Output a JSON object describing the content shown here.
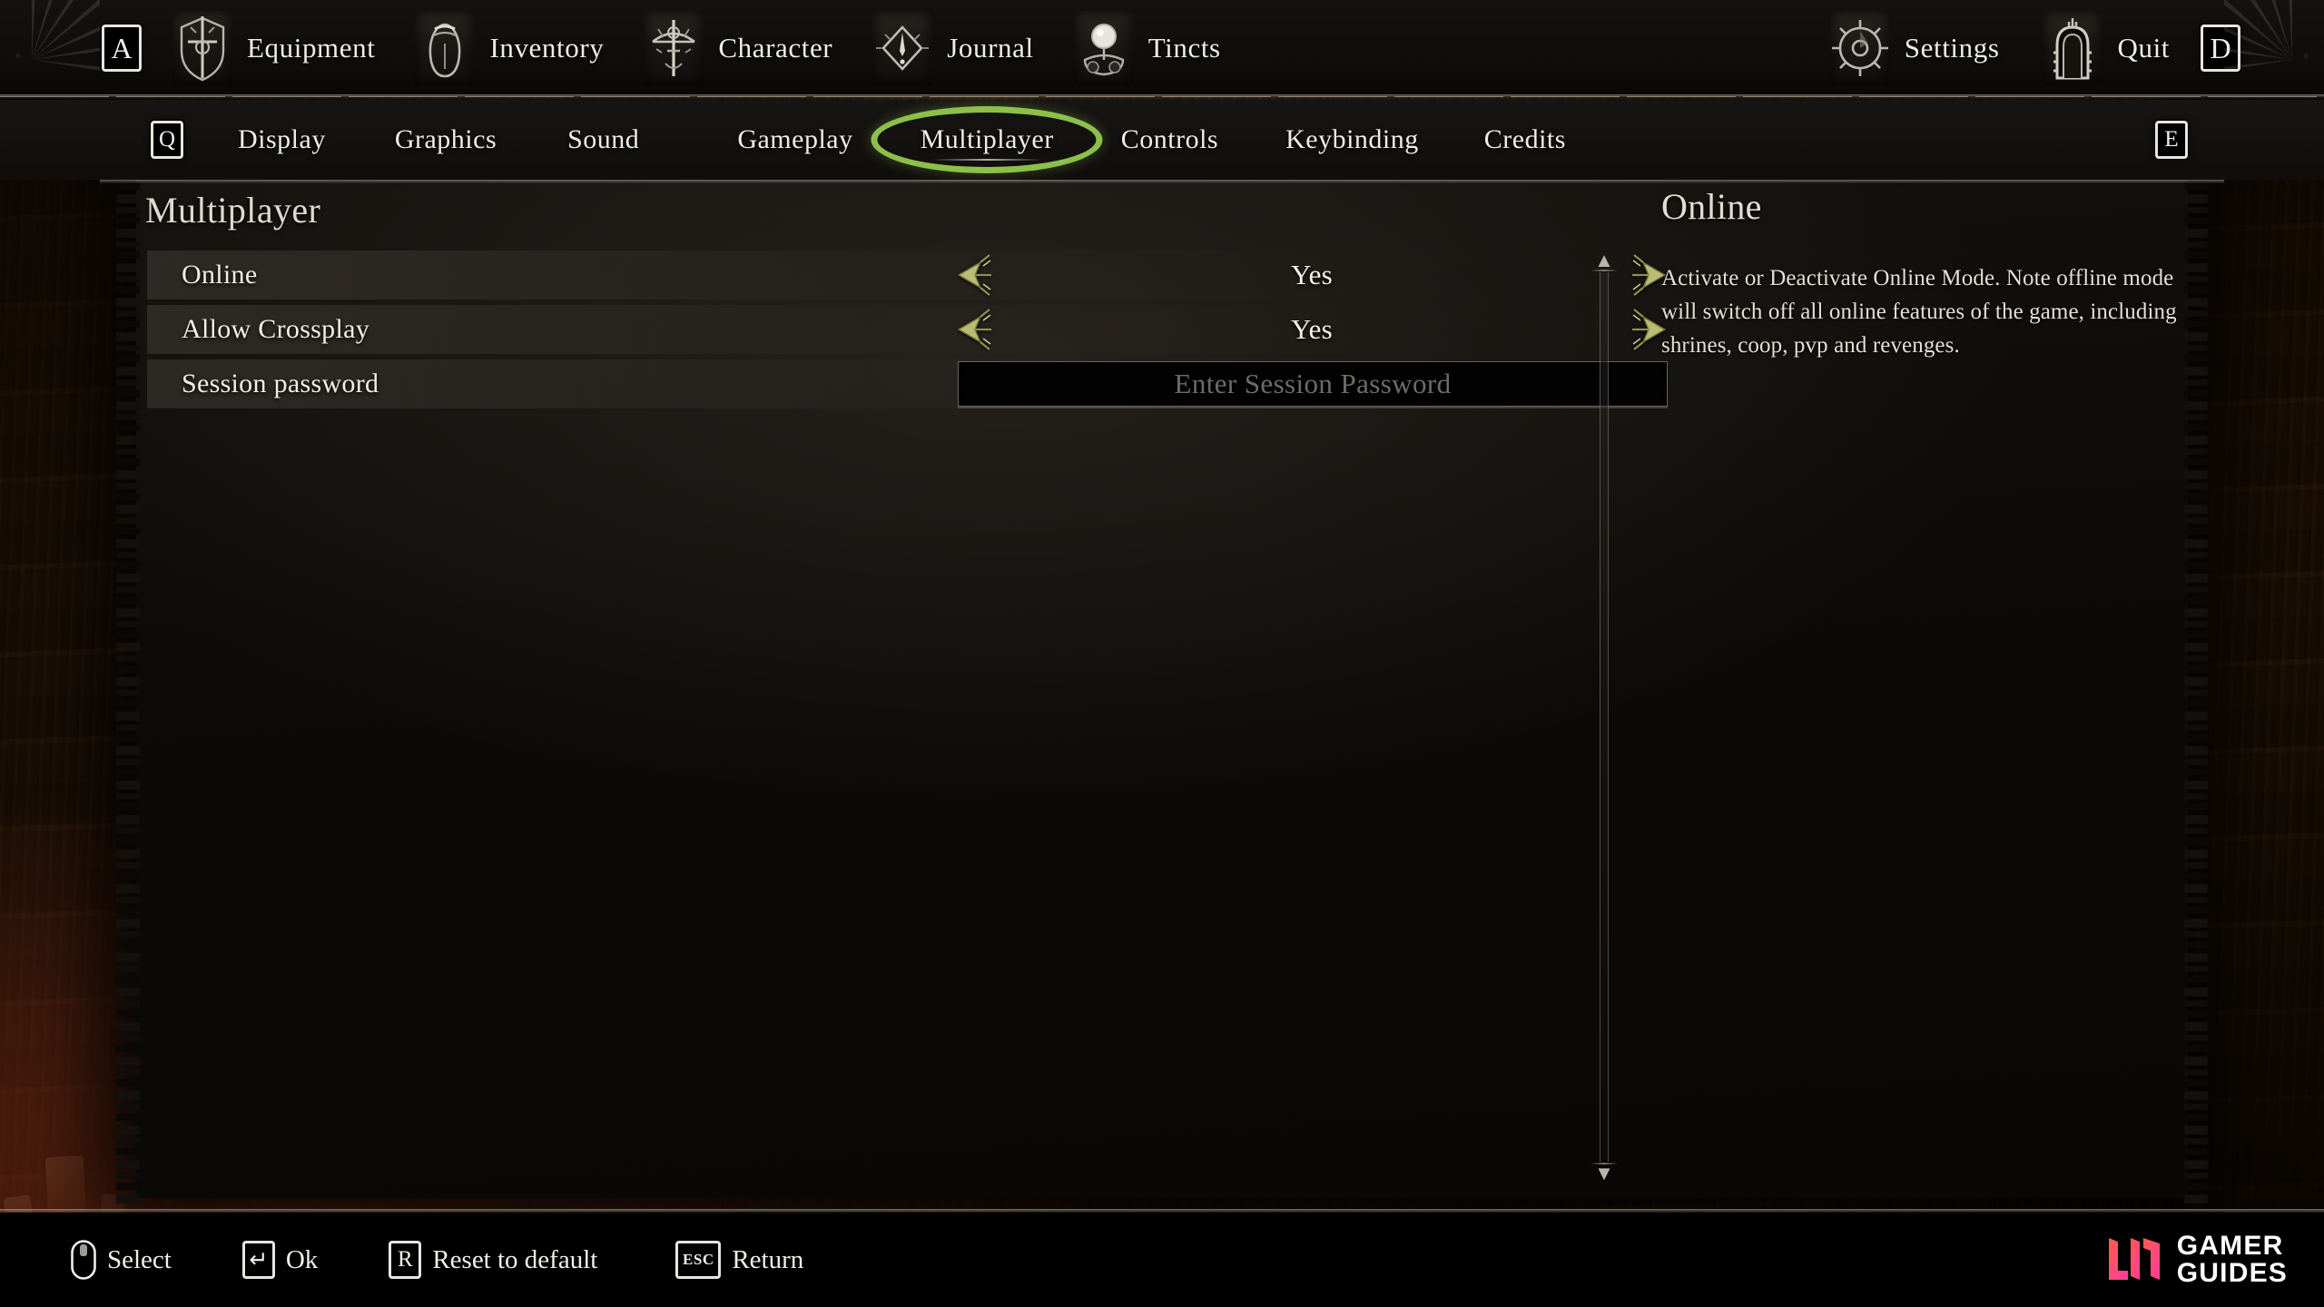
{
  "topbar": {
    "left_key": "A",
    "right_key": "D",
    "items": [
      {
        "label": "Equipment",
        "icon": "shield-sword-icon",
        "glyph": "⚔"
      },
      {
        "label": "Inventory",
        "icon": "satchel-icon",
        "glyph": "Ἱ2"
      },
      {
        "label": "Character",
        "icon": "crest-icon",
        "glyph": "☨"
      },
      {
        "label": "Journal",
        "icon": "tome-icon",
        "glyph": "❖"
      },
      {
        "label": "Tincts",
        "icon": "flask-orb-icon",
        "glyph": "●"
      }
    ],
    "right_items": [
      {
        "label": "Settings",
        "icon": "gear-icon",
        "glyph": "⚙"
      },
      {
        "label": "Quit",
        "icon": "door-icon",
        "glyph": "⛩"
      }
    ]
  },
  "tabs": {
    "prev_key": "Q",
    "next_key": "E",
    "accent_color": "#8cc04a",
    "items": [
      {
        "label": "Display",
        "active": false
      },
      {
        "label": "Graphics",
        "active": false
      },
      {
        "label": "Sound",
        "active": false
      },
      {
        "label": "Gameplay",
        "active": false
      },
      {
        "label": "Multiplayer",
        "active": true
      },
      {
        "label": "Controls",
        "active": false
      },
      {
        "label": "Keybinding",
        "active": false
      },
      {
        "label": "Credits",
        "active": false
      }
    ]
  },
  "settings": {
    "section_title": "Multiplayer",
    "rows": [
      {
        "label": "Online",
        "type": "toggle",
        "value": "Yes"
      },
      {
        "label": "Allow Crossplay",
        "type": "toggle",
        "value": "Yes"
      },
      {
        "label": "Session password",
        "type": "text",
        "value": "",
        "placeholder": "Enter Session Password"
      }
    ]
  },
  "info": {
    "title": "Online",
    "body": "Activate or Deactivate Online Mode. Note offline mode will switch off all online features of the game, including shrines, coop, pvp and revenges."
  },
  "bottombar": {
    "hints": [
      {
        "key": "mouse",
        "label": "Select"
      },
      {
        "key": "↵",
        "label": "Ok"
      },
      {
        "key": "R",
        "label": "Reset to default"
      },
      {
        "key": "ESC",
        "label": "Return"
      }
    ]
  },
  "watermark": {
    "line1": "GAMER",
    "line2": "GUIDES",
    "color_start": "#ff5a4d",
    "color_end": "#ff3d9e"
  }
}
